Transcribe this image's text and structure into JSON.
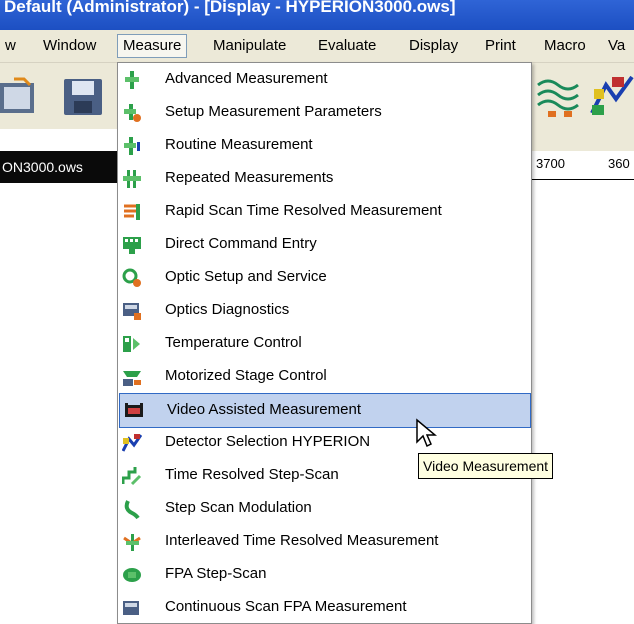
{
  "window": {
    "title": "Default  (Administrator) - [Display - HYPERION3000.ows]"
  },
  "menubar": {
    "items": [
      "w",
      "Window",
      "Measure",
      "Manipulate",
      "Evaluate",
      "Display",
      "Print",
      "Macro",
      "Va"
    ],
    "active": "Measure"
  },
  "file_tab": {
    "label": "ON3000.ows"
  },
  "axis_ticks": [
    "3700",
    "360"
  ],
  "measure_menu": {
    "items": [
      {
        "label": "Advanced Measurement",
        "icon": "advanced-measurement-icon"
      },
      {
        "label": "Setup Measurement Parameters",
        "icon": "setup-parameters-icon"
      },
      {
        "label": "Routine Measurement",
        "icon": "routine-measurement-icon"
      },
      {
        "label": "Repeated Measurements",
        "icon": "repeated-measurements-icon"
      },
      {
        "label": "Rapid Scan Time Resolved Measurement",
        "icon": "rapid-scan-icon"
      },
      {
        "label": "Direct Command Entry",
        "icon": "command-entry-icon"
      },
      {
        "label": "Optic Setup and Service",
        "icon": "optic-setup-icon"
      },
      {
        "label": "Optics Diagnostics",
        "icon": "optics-diagnostics-icon"
      },
      {
        "label": "Temperature Control",
        "icon": "temperature-control-icon"
      },
      {
        "label": "Motorized Stage Control",
        "icon": "motorized-stage-icon"
      },
      {
        "label": "Video Assisted Measurement",
        "icon": "video-measurement-icon"
      },
      {
        "label": "Detector Selection HYPERION",
        "icon": "detector-selection-icon"
      },
      {
        "label": "Time Resolved Step-Scan",
        "icon": "step-scan-icon"
      },
      {
        "label": "Step Scan Modulation",
        "icon": "step-scan-modulation-icon"
      },
      {
        "label": "Interleaved Time Resolved Measurement",
        "icon": "interleaved-measurement-icon"
      },
      {
        "label": "FPA Step-Scan",
        "icon": "fpa-step-scan-icon"
      },
      {
        "label": "Continuous Scan FPA Measurement",
        "icon": "continuous-scan-fpa-icon"
      }
    ],
    "highlighted_index": 10
  },
  "tooltip": {
    "text": "Video Measurement"
  },
  "colors": {
    "title_bar": "#1c4fc2",
    "menu_highlight": "#c1d2ee",
    "menu_border": "#316ac5",
    "tooltip_bg": "#ffffe1"
  }
}
